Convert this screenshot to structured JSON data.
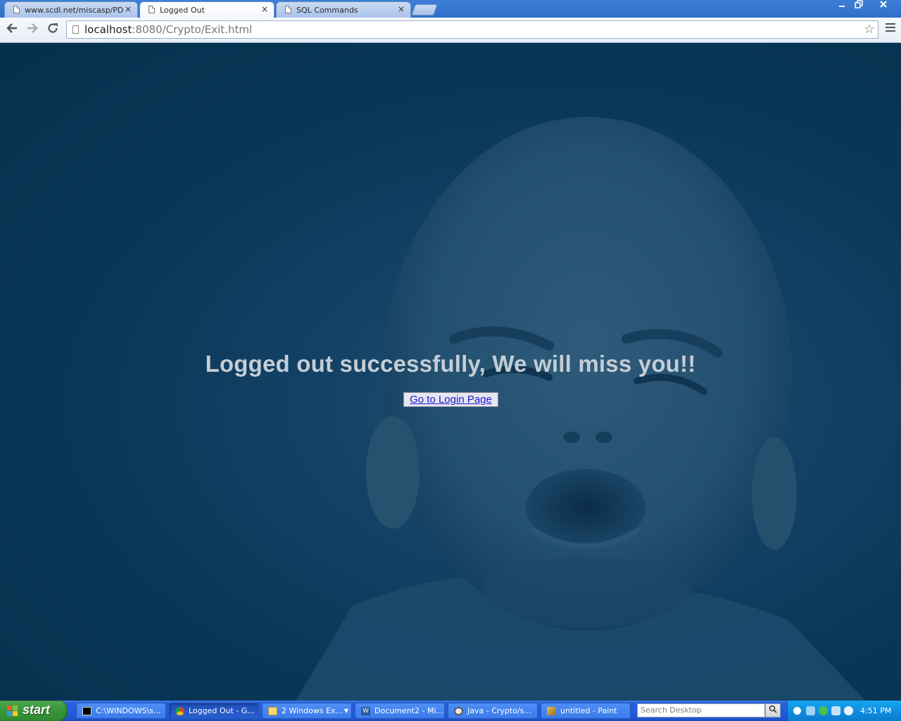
{
  "browser": {
    "tabs": [
      {
        "title": "www.scdl.net/miscasp/PDFS",
        "active": false
      },
      {
        "title": "Logged Out",
        "active": true
      },
      {
        "title": "SQL Commands",
        "active": false
      }
    ],
    "tab_close_glyph": "×",
    "url_host": "localhost",
    "url_rest": ":8080/Crypto/Exit.html"
  },
  "page": {
    "headline": "Logged out successfully, We will miss you!!",
    "login_button": "Go to Login Page"
  },
  "taskbar": {
    "start_label": "start",
    "tasks": [
      {
        "label": "C:\\WINDOWS\\s...",
        "icon": "cmd-icon",
        "active": false
      },
      {
        "label": "Logged Out - G...",
        "icon": "chrome-icon",
        "active": true
      },
      {
        "label": "2 Windows Ex...",
        "icon": "folder-icon",
        "active": false
      },
      {
        "label": "Document2 - Mi...",
        "icon": "word-icon",
        "active": false
      },
      {
        "label": "Java - Crypto/s...",
        "icon": "eclipse-icon",
        "active": false
      },
      {
        "label": "untitled - Paint",
        "icon": "paint-icon",
        "active": false
      }
    ],
    "search_placeholder": "Search Desktop",
    "clock": "4:51 PM"
  },
  "colors": {
    "page_background": "#0c3a5c",
    "headline": "#c4cdd5",
    "link": "#1a1ad0",
    "taskbar": "#245cdb",
    "start_button": "#38953a"
  }
}
